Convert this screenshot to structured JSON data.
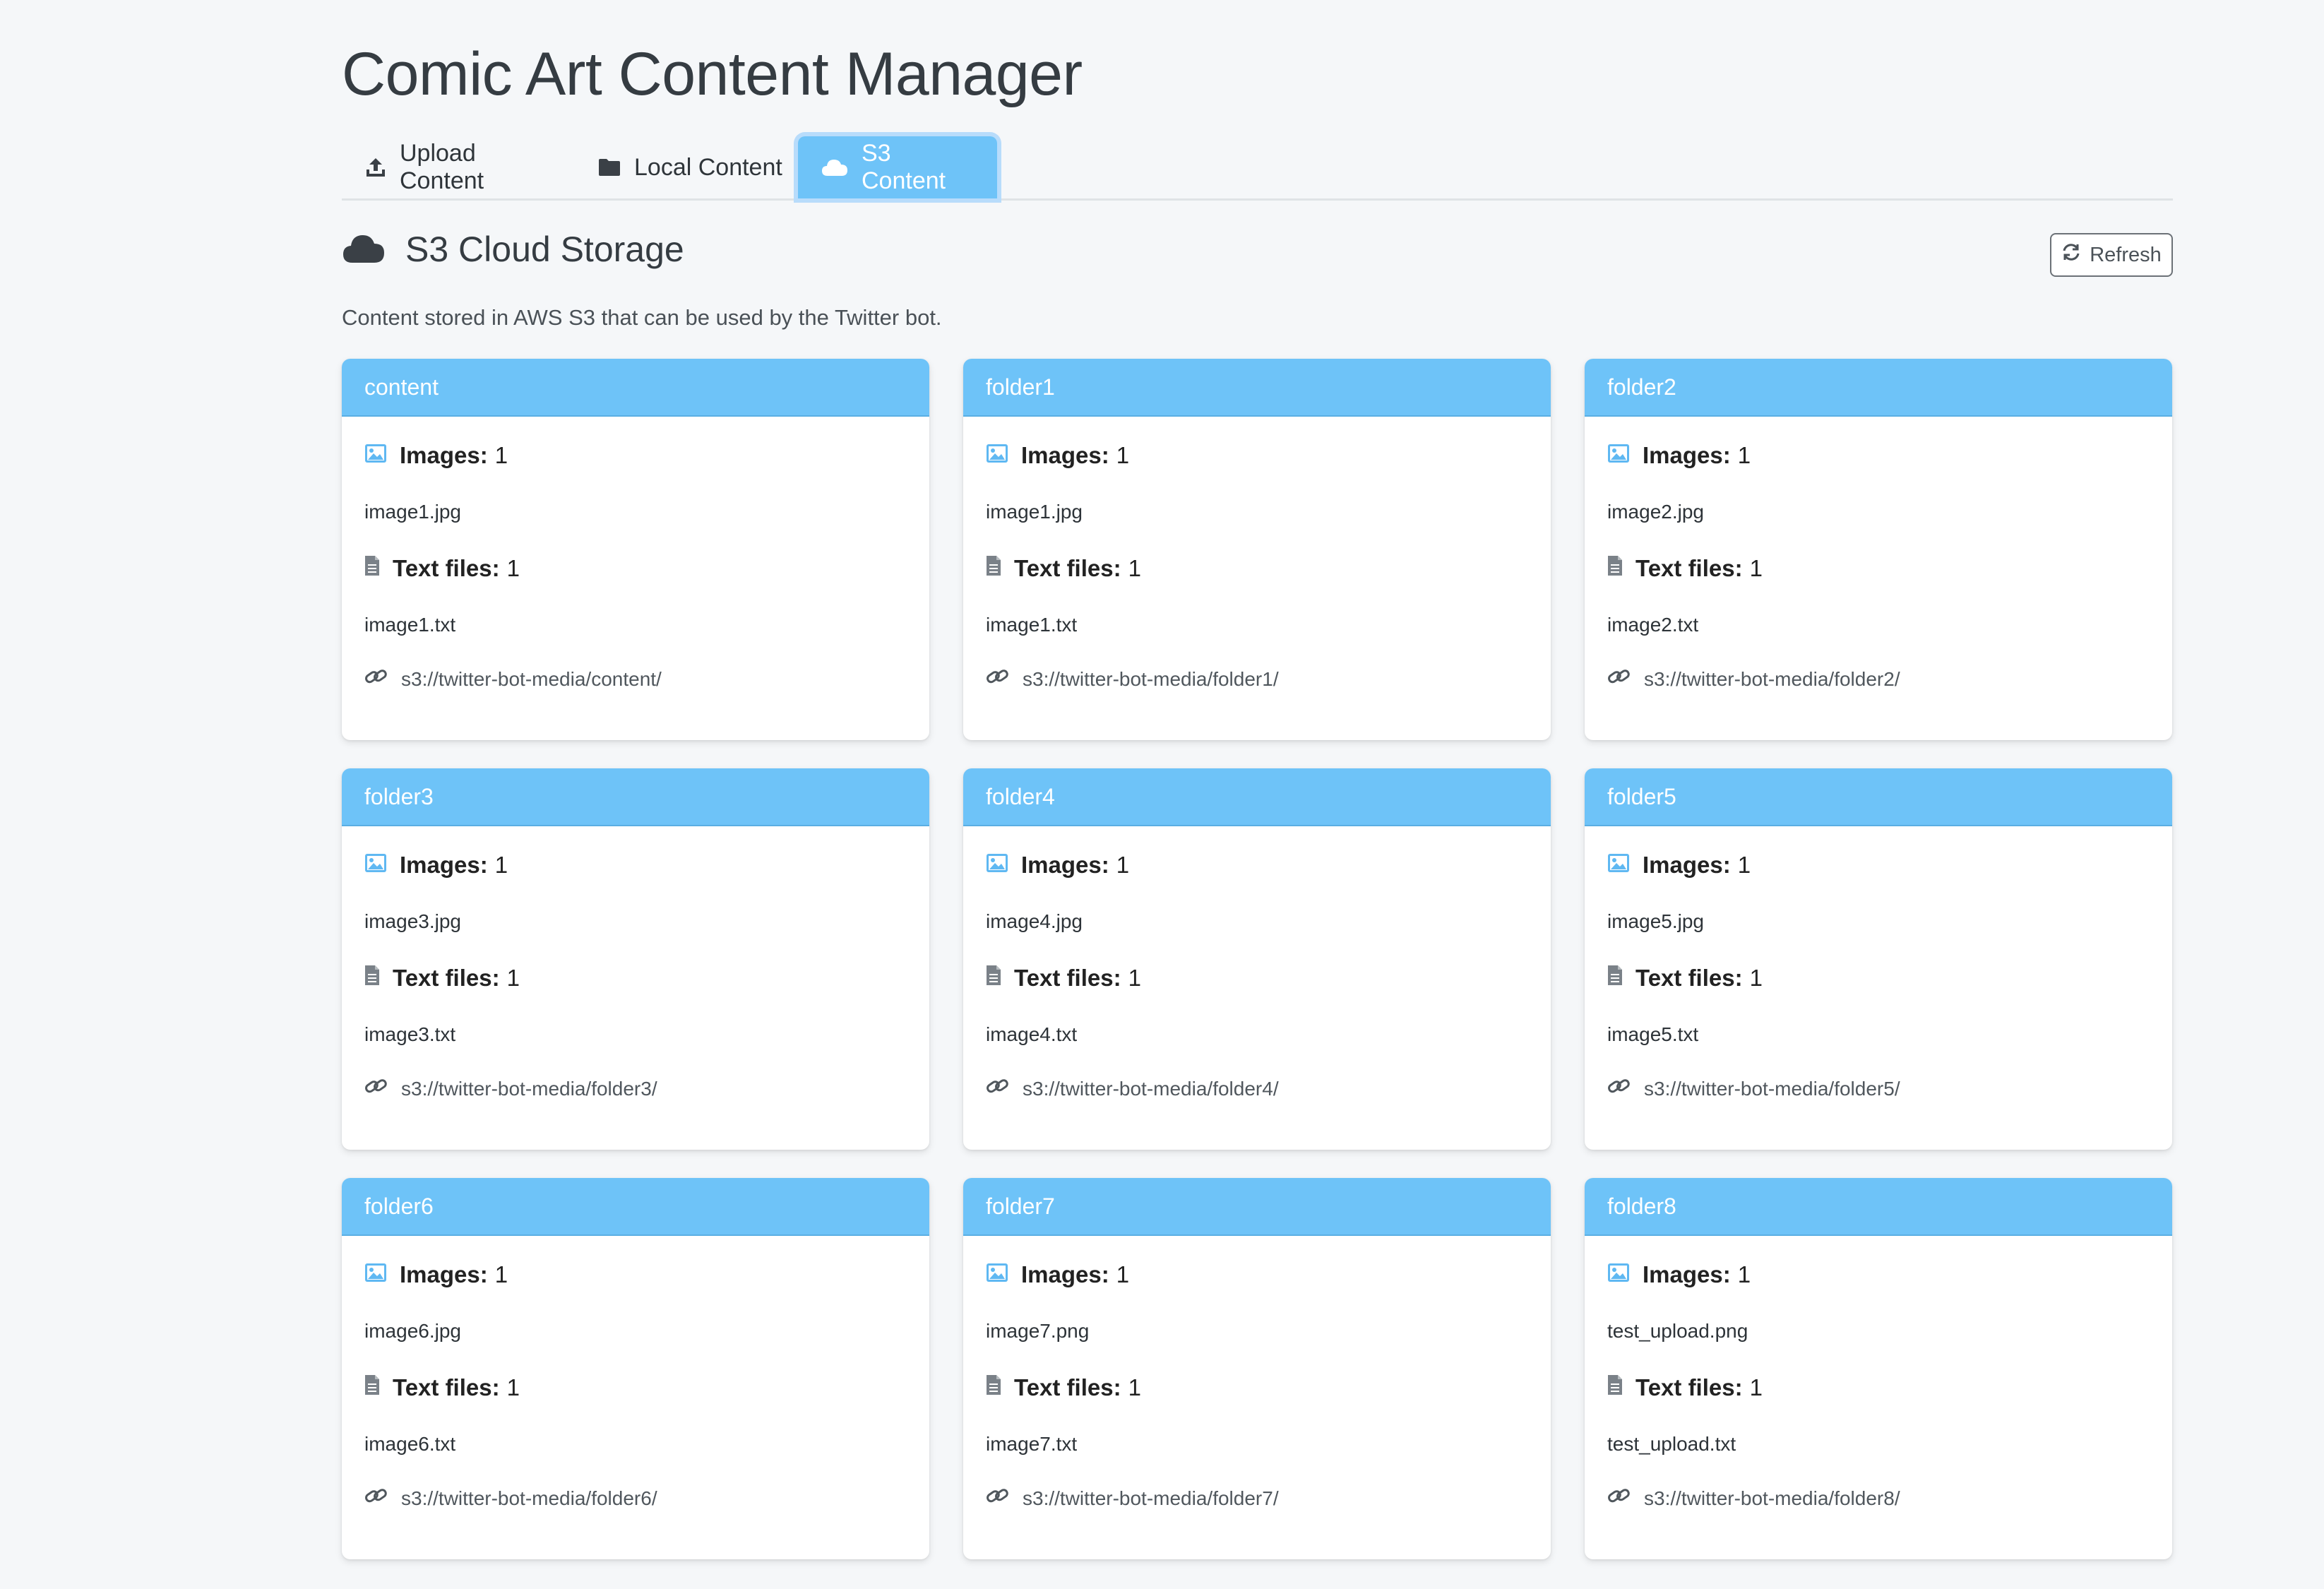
{
  "app": {
    "title": "Comic Art Content Manager"
  },
  "tabs": [
    {
      "label": "Upload Content",
      "icon": "upload-icon"
    },
    {
      "label": "Local Content",
      "icon": "folder-icon"
    },
    {
      "label": "S3 Content",
      "icon": "cloud-icon",
      "active": true
    }
  ],
  "section": {
    "title": "S3 Cloud Storage",
    "refresh_label": "Refresh",
    "description": "Content stored in AWS S3 that can be used by the Twitter bot."
  },
  "labels": {
    "images": "Images:",
    "text_files": "Text files:"
  },
  "colors": {
    "accent": "#6ec3f8",
    "background": "#f5f7f9"
  },
  "folders": [
    {
      "name": "content",
      "images_count": "1",
      "image_file": "image1.jpg",
      "text_count": "1",
      "text_file": "image1.txt",
      "path": "s3://twitter-bot-media/content/"
    },
    {
      "name": "folder1",
      "images_count": "1",
      "image_file": "image1.jpg",
      "text_count": "1",
      "text_file": "image1.txt",
      "path": "s3://twitter-bot-media/folder1/"
    },
    {
      "name": "folder2",
      "images_count": "1",
      "image_file": "image2.jpg",
      "text_count": "1",
      "text_file": "image2.txt",
      "path": "s3://twitter-bot-media/folder2/"
    },
    {
      "name": "folder3",
      "images_count": "1",
      "image_file": "image3.jpg",
      "text_count": "1",
      "text_file": "image3.txt",
      "path": "s3://twitter-bot-media/folder3/"
    },
    {
      "name": "folder4",
      "images_count": "1",
      "image_file": "image4.jpg",
      "text_count": "1",
      "text_file": "image4.txt",
      "path": "s3://twitter-bot-media/folder4/"
    },
    {
      "name": "folder5",
      "images_count": "1",
      "image_file": "image5.jpg",
      "text_count": "1",
      "text_file": "image5.txt",
      "path": "s3://twitter-bot-media/folder5/"
    },
    {
      "name": "folder6",
      "images_count": "1",
      "image_file": "image6.jpg",
      "text_count": "1",
      "text_file": "image6.txt",
      "path": "s3://twitter-bot-media/folder6/"
    },
    {
      "name": "folder7",
      "images_count": "1",
      "image_file": "image7.png",
      "text_count": "1",
      "text_file": "image7.txt",
      "path": "s3://twitter-bot-media/folder7/"
    },
    {
      "name": "folder8",
      "images_count": "1",
      "image_file": "test_upload.png",
      "text_count": "1",
      "text_file": "test_upload.txt",
      "path": "s3://twitter-bot-media/folder8/"
    }
  ]
}
